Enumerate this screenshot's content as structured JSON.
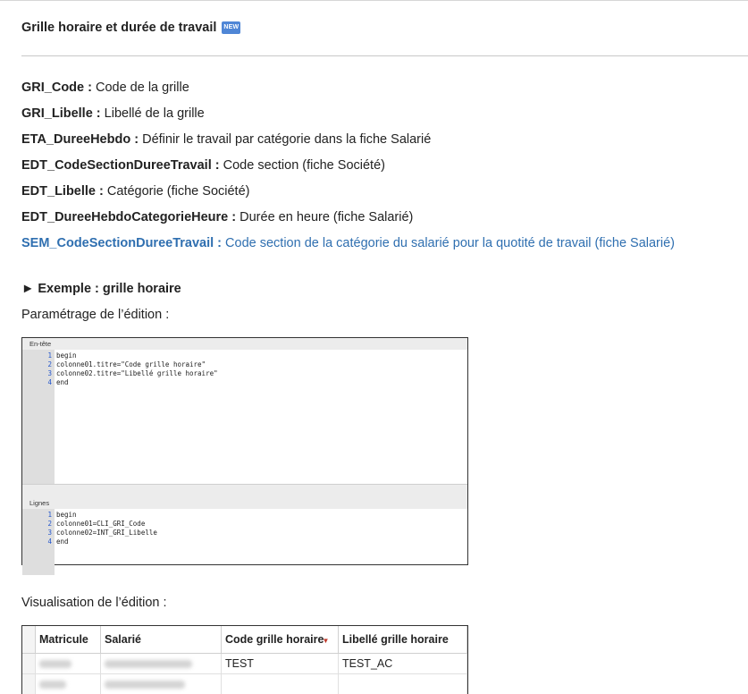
{
  "section": {
    "title": "Grille horaire et durée de travail",
    "badge": "NEW"
  },
  "definitions": [
    {
      "key": "GRI_Code :",
      "desc": " Code de la grille"
    },
    {
      "key": "GRI_Libelle :",
      "desc": " Libellé de la grille"
    },
    {
      "key": "ETA_DureeHebdo :",
      "desc": " Définir le travail par catégorie dans la fiche Salarié"
    },
    {
      "key": "EDT_CodeSectionDureeTravail :",
      "desc": " Code section (fiche Société)"
    },
    {
      "key": "EDT_Libelle :",
      "desc": " Catégorie (fiche Société)"
    },
    {
      "key": "EDT_DureeHebdoCategorieHeure :",
      "desc": " Durée en heure (fiche Salarié)"
    },
    {
      "key": "SEM_CodeSectionDureeTravail :",
      "desc": " Code section de la catégorie du salarié pour la quotité de travail (fiche Salarié)"
    }
  ],
  "example": {
    "title": "► Exemple : grille horaire",
    "param_label": "Paramétrage de l’édition :",
    "visu_label": "Visualisation de l’édition :"
  },
  "editor": {
    "header_pane_title": "En-tête",
    "header_lines": [
      "begin",
      "colonne01.titre=\"Code grille horaire\"",
      "colonne02.titre=\"Libellé grille horaire\"",
      "end"
    ],
    "lines_pane_title": "Lignes",
    "body_lines": [
      "begin",
      "colonne01=CLI_GRI_Code",
      "colonne02=INT_GRI_Libelle",
      "end"
    ],
    "line_numbers": [
      "1",
      "2",
      "3",
      "4"
    ]
  },
  "grid": {
    "columns": [
      "Matricule",
      "Salarié",
      "Code grille horaire",
      "Libellé grille horaire"
    ],
    "row1": {
      "code": "TEST",
      "libelle": "TEST_AC"
    }
  }
}
